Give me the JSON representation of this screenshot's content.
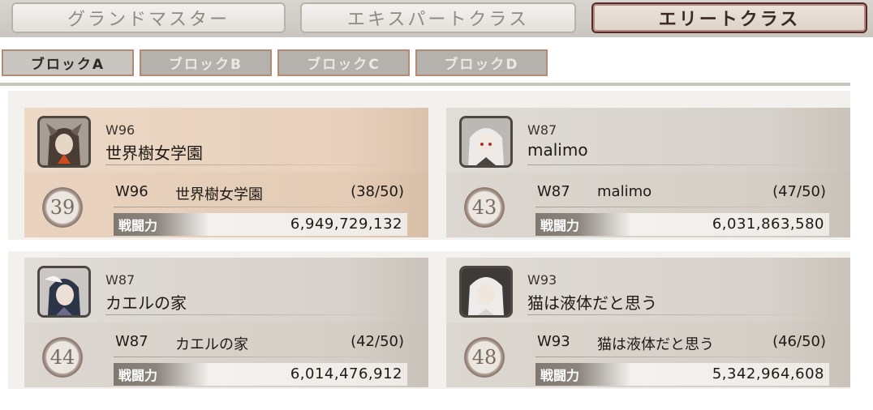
{
  "tabs": [
    {
      "label": "グランドマスター",
      "active": false
    },
    {
      "label": "エキスパートクラス",
      "active": false
    },
    {
      "label": "エリートクラス",
      "active": true
    }
  ],
  "blocks": [
    {
      "label": "ブロックA",
      "active": true
    },
    {
      "label": "ブロックB",
      "active": false
    },
    {
      "label": "ブロックC",
      "active": false
    },
    {
      "label": "ブロックD",
      "active": false
    }
  ],
  "guilds": [
    {
      "world": "W96",
      "name": "世界樹女学園",
      "rank": "39",
      "count": "(38/50)",
      "power_label": "戦闘力",
      "power": "6,949,729,132",
      "highlight": true
    },
    {
      "world": "W87",
      "name": "malimo",
      "rank": "43",
      "count": "(47/50)",
      "power_label": "戦闘力",
      "power": "6,031,863,580",
      "highlight": false
    },
    {
      "world": "W87",
      "name": "カエルの家",
      "rank": "44",
      "count": "(42/50)",
      "power_label": "戦闘力",
      "power": "6,014,476,912",
      "highlight": false
    },
    {
      "world": "W93",
      "name": "猫は液体だと思う",
      "rank": "48",
      "count": "(46/50)",
      "power_label": "戦闘力",
      "power": "5,342,964,608",
      "highlight": false
    }
  ],
  "colors": {
    "accent_border": "#5a2a28",
    "highlight_card": "#e7d1bc"
  }
}
